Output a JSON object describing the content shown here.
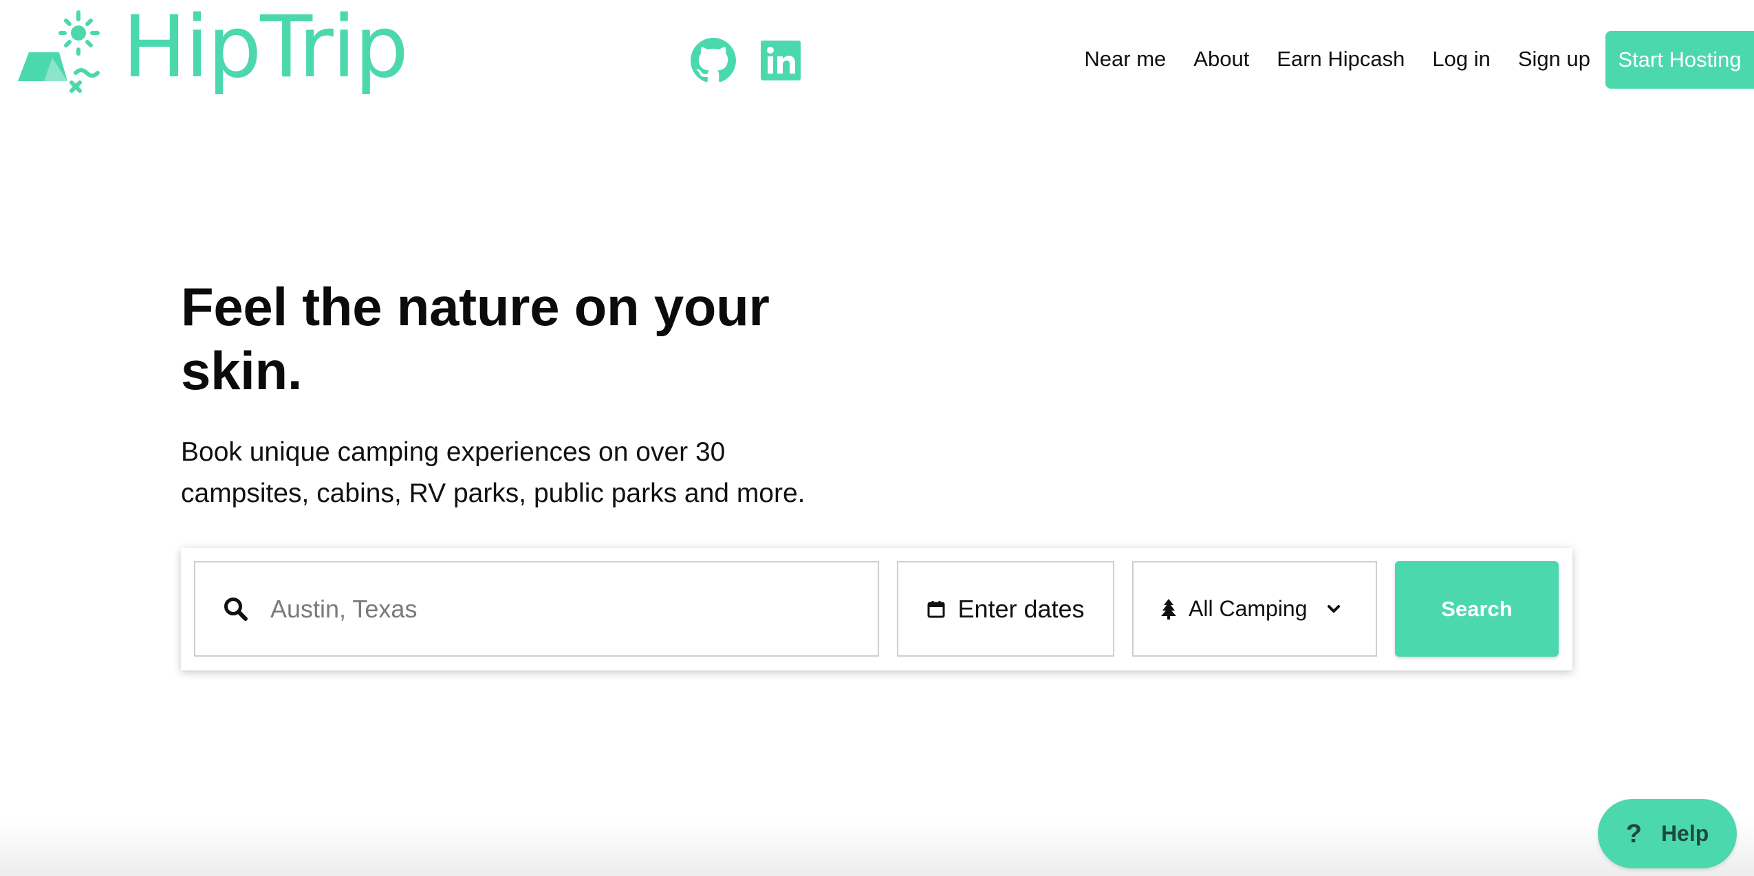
{
  "brand": {
    "name": "HipTrip",
    "logo_icon": "sun-tent-logo-icon",
    "accent_color": "#4cd8ad"
  },
  "header": {
    "social": [
      {
        "icon": "github-icon"
      },
      {
        "icon": "linkedin-icon"
      }
    ],
    "nav": {
      "near_me": "Near me",
      "about": "About",
      "earn_hipcash": "Earn Hipcash",
      "log_in": "Log in",
      "sign_up": "Sign up"
    },
    "cta": "Start Hosting"
  },
  "hero": {
    "title_line1": "Feel the nature on your",
    "title_line2": "skin.",
    "subtitle_line1": "Book unique camping experiences on over 30",
    "subtitle_line2": "campsites, cabins, RV parks, public parks and more."
  },
  "search": {
    "location_placeholder": "Austin, Texas",
    "location_value": "",
    "location_icon": "search-icon",
    "dates_icon": "calendar-icon",
    "dates_label": "Enter dates",
    "type_icon": "tree-icon",
    "type_selected": "All Camping",
    "type_dropdown_icon": "chevron-down-icon",
    "button_label": "Search"
  },
  "help": {
    "icon": "?",
    "label": "Help",
    "background": "#4cd8ad",
    "text_color": "#1d4a3c"
  }
}
